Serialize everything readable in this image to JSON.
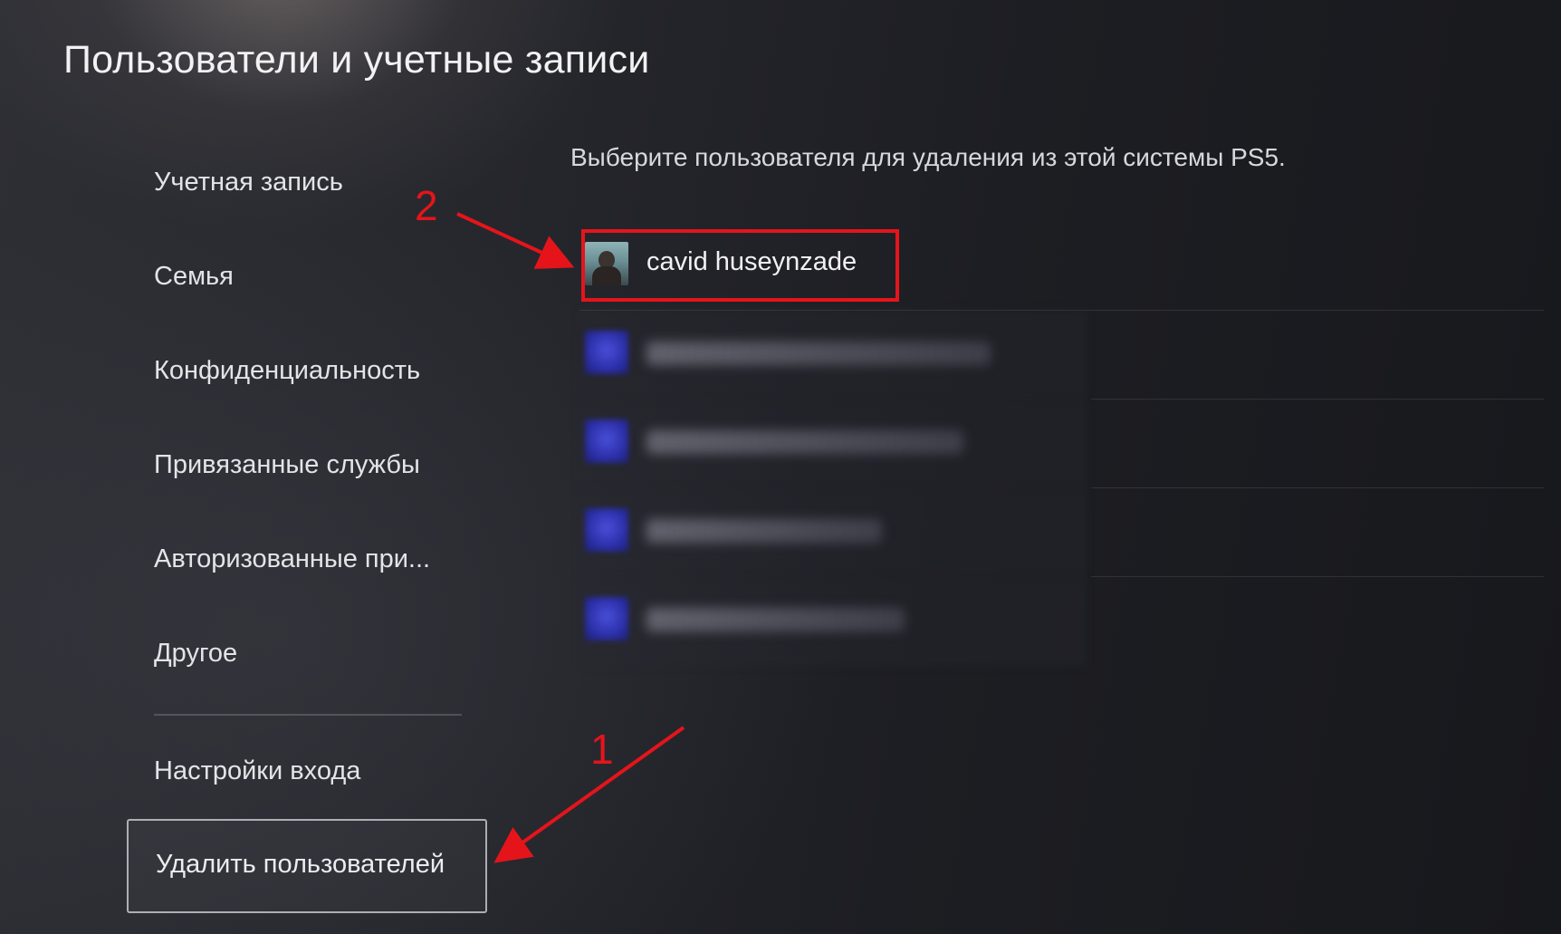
{
  "page": {
    "title": "Пользователи и учетные записи"
  },
  "menu": {
    "items": [
      {
        "label": "Учетная запись"
      },
      {
        "label": "Семья"
      },
      {
        "label": "Конфиденциальность"
      },
      {
        "label": "Привязанные службы"
      },
      {
        "label": "Авторизованные при..."
      },
      {
        "label": "Другое"
      },
      {
        "label": "Настройки входа"
      }
    ],
    "selected_label": "Удалить пользователей"
  },
  "content": {
    "instruction": "Выберите пользователя для удаления из этой системы PS5.",
    "users": [
      {
        "name": "cavid huseynzade",
        "avatar": "photo-avatar"
      },
      {
        "name": "",
        "avatar": "default-blue-avatar",
        "obscured": true
      },
      {
        "name": "",
        "avatar": "default-blue-avatar",
        "obscured": true
      },
      {
        "name": "",
        "avatar": "default-blue-avatar",
        "obscured": true
      },
      {
        "name": "",
        "avatar": "default-blue-avatar",
        "obscured": true
      }
    ]
  },
  "annotations": {
    "step1": "1",
    "step2": "2",
    "color": "#e5141b"
  }
}
